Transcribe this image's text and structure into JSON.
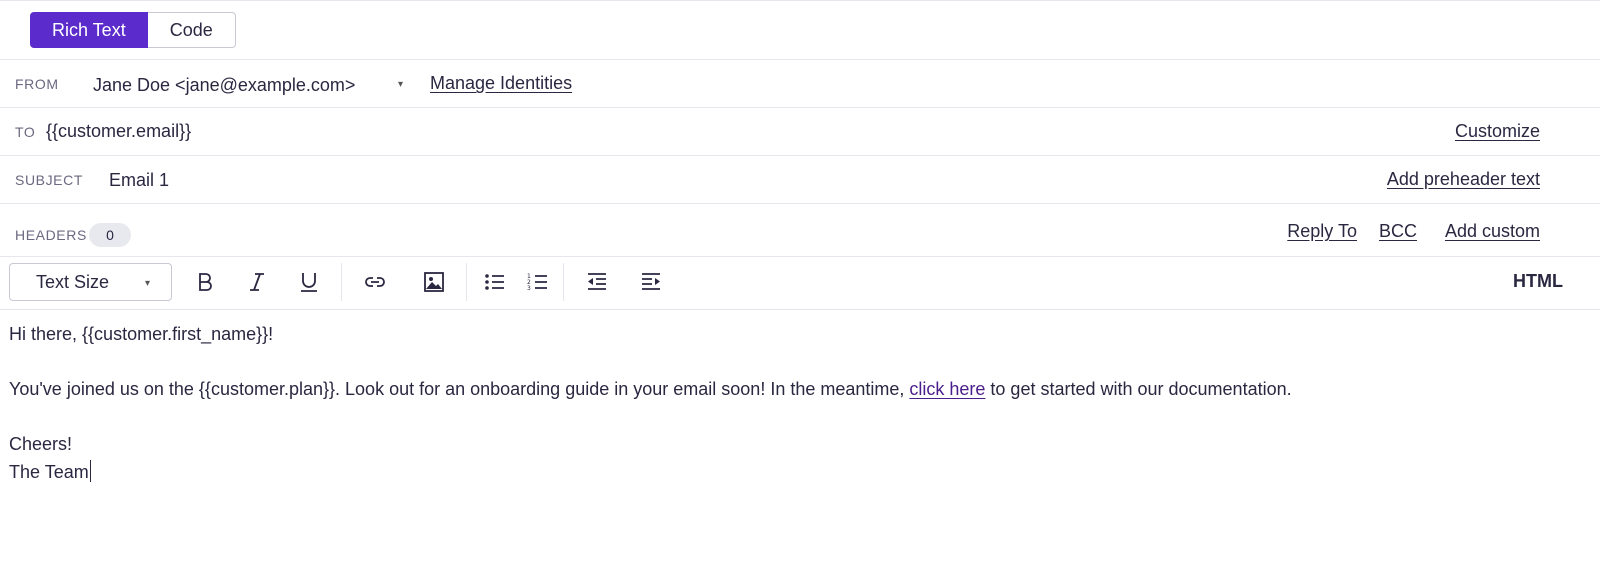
{
  "mode_toggle": {
    "rich_text": "Rich Text",
    "code": "Code",
    "active": "rich_text"
  },
  "from": {
    "label": "FROM",
    "value": "Jane Doe <jane@example.com>",
    "manage_link": "Manage Identities"
  },
  "to": {
    "label": "TO",
    "value": "{{customer.email}}",
    "customize_link": "Customize"
  },
  "subject": {
    "label": "SUBJECT",
    "value": "Email 1",
    "preheader_link": "Add preheader text"
  },
  "headers": {
    "label": "HEADERS",
    "count": "0",
    "reply_to": "Reply To",
    "bcc": "BCC",
    "add_custom": "Add custom"
  },
  "toolbar": {
    "text_size_label": "Text Size",
    "html_label": "HTML",
    "icons": [
      "bold-icon",
      "italic-icon",
      "underline-icon",
      "link-icon",
      "image-icon",
      "bulleted-list-icon",
      "numbered-list-icon",
      "outdent-icon",
      "indent-icon"
    ]
  },
  "body": {
    "greeting": "Hi there, {{customer.first_name}}!",
    "para_before_link": "You've joined us on the {{customer.plan}}. Look out for an onboarding guide in your email soon! In the meantime, ",
    "link_text": "click here",
    "para_after_link": " to get started with our documentation.",
    "signoff": "Cheers!",
    "signature": "The Team"
  },
  "colors": {
    "accent": "#5b2bcc",
    "text": "#2a2740",
    "muted": "#6b6880",
    "border": "#e6e6ec",
    "link": "#4a1d8c"
  }
}
